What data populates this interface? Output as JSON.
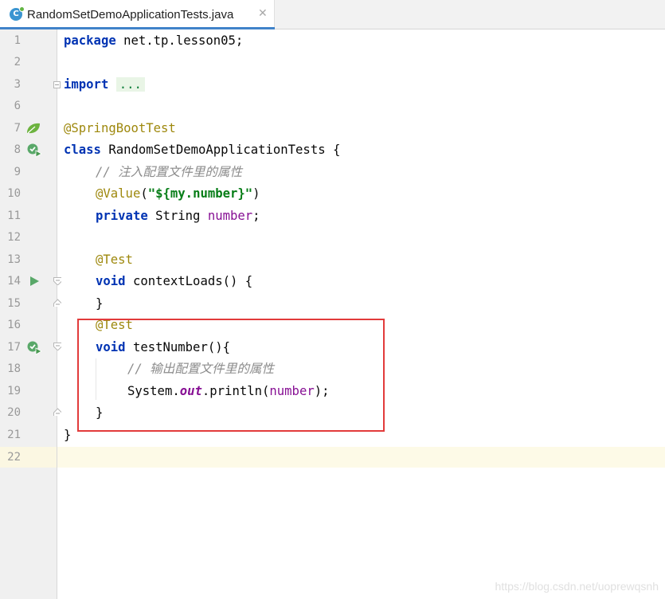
{
  "tab": {
    "title": "RandomSetDemoApplicationTests.java",
    "icon": "java-class-icon",
    "icon_letter": "C",
    "close": "✕"
  },
  "colors": {
    "keyword": "#0033b3",
    "annotation": "#9e880d",
    "comment": "#8c8c8c",
    "string": "#067d17",
    "field": "#871094",
    "highlight_box": "#e23b3b"
  },
  "lines": {
    "l1": {
      "num": "1",
      "kw": "package",
      "rest": " net.tp.lesson05;"
    },
    "l2": {
      "num": "2"
    },
    "l3": {
      "num": "3",
      "kw": "import",
      "folded": "..."
    },
    "l6": {
      "num": "6"
    },
    "l7": {
      "num": "7",
      "annotation": "@SpringBootTest"
    },
    "l8": {
      "num": "8",
      "kw": "class",
      "rest": " RandomSetDemoApplicationTests {"
    },
    "l9": {
      "num": "9",
      "comment": "// 注入配置文件里的属性"
    },
    "l10": {
      "num": "10",
      "annotation": "@Value",
      "open": "(",
      "string": "\"${my.number}\"",
      "close": ")"
    },
    "l11": {
      "num": "11",
      "kw": "private",
      "type": " String ",
      "field": "number",
      "end": ";"
    },
    "l12": {
      "num": "12"
    },
    "l13": {
      "num": "13",
      "annotation": "@Test"
    },
    "l14": {
      "num": "14",
      "kw": "void",
      "rest": " contextLoads() {"
    },
    "l15": {
      "num": "15",
      "rest": "}"
    },
    "l16": {
      "num": "16",
      "annotation": "@Test"
    },
    "l17": {
      "num": "17",
      "kw": "void",
      "rest": " testNumber(){"
    },
    "l18": {
      "num": "18",
      "comment": "// 输出配置文件里的属性"
    },
    "l19": {
      "num": "19",
      "pre": "System.",
      "static": "out",
      "mid": ".println(",
      "field": "number",
      "end": ");"
    },
    "l20": {
      "num": "20",
      "rest": "}"
    },
    "l21": {
      "num": "21",
      "rest": "}"
    },
    "l22": {
      "num": "22"
    }
  },
  "watermark": "https://blog.csdn.net/uoprewqsnh"
}
